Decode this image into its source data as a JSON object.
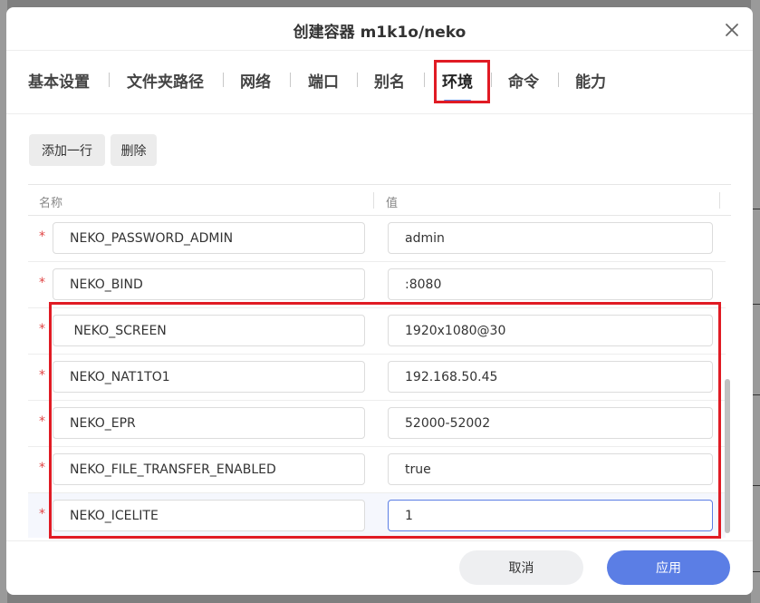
{
  "dialog": {
    "title": "创建容器 m1k1o/neko"
  },
  "tabs": [
    {
      "label": "基本设置",
      "active": false
    },
    {
      "label": "文件夹路径",
      "active": false
    },
    {
      "label": "网络",
      "active": false
    },
    {
      "label": "端口",
      "active": false
    },
    {
      "label": "别名",
      "active": false
    },
    {
      "label": "环境",
      "active": true
    },
    {
      "label": "命令",
      "active": false
    },
    {
      "label": "能力",
      "active": false
    }
  ],
  "toolbar": {
    "add_row_label": "添加一行",
    "delete_label": "删除"
  },
  "table": {
    "headers": {
      "name": "名称",
      "value": "值"
    },
    "required_mark": "*",
    "rows": [
      {
        "name": "NEKO_PASSWORD_ADMIN",
        "value": "admin"
      },
      {
        "name": "NEKO_BIND",
        "value": ":8080"
      },
      {
        "name": " NEKO_SCREEN",
        "value": "1920x1080@30"
      },
      {
        "name": "NEKO_NAT1TO1",
        "value": "192.168.50.45"
      },
      {
        "name": "NEKO_EPR",
        "value": "52000-52002"
      },
      {
        "name": "NEKO_FILE_TRANSFER_ENABLED",
        "value": "true"
      },
      {
        "name": "NEKO_ICELITE",
        "value": "1"
      }
    ]
  },
  "footer": {
    "cancel_label": "取消",
    "apply_label": "应用"
  },
  "colors": {
    "accent": "#5b7ee5",
    "highlight": "#e01b24",
    "required": "#e04545"
  }
}
